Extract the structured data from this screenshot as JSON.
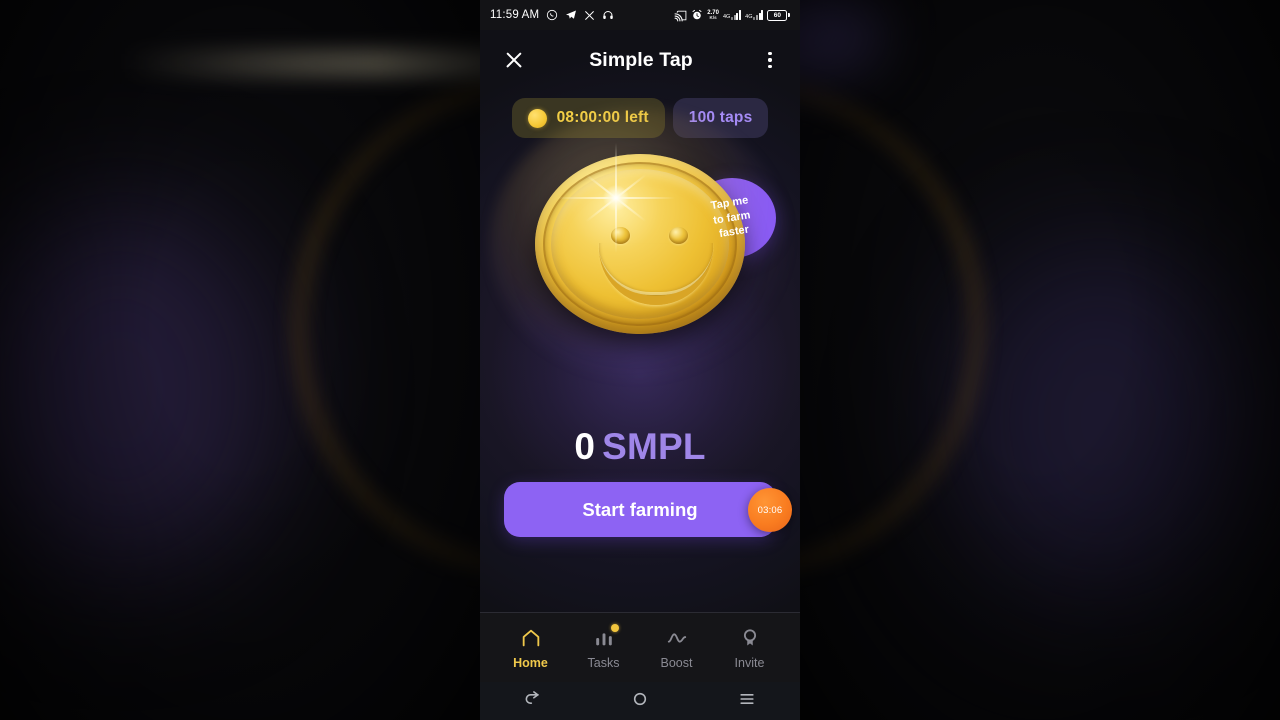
{
  "status_bar": {
    "time": "11:59 AM",
    "left_icons": [
      "whatsapp-icon",
      "telegram-icon",
      "x-icon",
      "headphone-icon"
    ],
    "network_speed": "2.70",
    "network_speed_unit": "K/s",
    "sim1_network": "4G",
    "sim2_network": "4G",
    "battery_percent": "60",
    "right_icons": [
      "cast-icon",
      "alarm-icon"
    ]
  },
  "app_bar": {
    "close_label": "close-icon",
    "title": "Simple Tap",
    "menu_label": "more-options-icon"
  },
  "badges": {
    "timer_text": "08:00:00 left",
    "taps_text": "100 taps"
  },
  "tooltip": {
    "line1": "Tap me",
    "line2": "to farm",
    "line3": "faster"
  },
  "balance": {
    "amount": "0",
    "currency": "SMPL"
  },
  "cta": {
    "label": "Start farming"
  },
  "recorder": {
    "elapsed": "03:06"
  },
  "bottom_nav": {
    "items": [
      {
        "label": "Home",
        "icon": "home-icon",
        "active": true,
        "badge": false
      },
      {
        "label": "Tasks",
        "icon": "chart-icon",
        "active": false,
        "badge": true
      },
      {
        "label": "Boost",
        "icon": "trend-icon",
        "active": false,
        "badge": false
      },
      {
        "label": "Invite",
        "icon": "medal-icon",
        "active": false,
        "badge": false
      }
    ]
  },
  "android_nav": {
    "back": "back-icon",
    "home": "home-circle-icon",
    "recents": "recents-icon"
  },
  "colors": {
    "accent_purple": "#8d63f3",
    "gold": "#f3cf46",
    "badge_taps_text": "#a58bf5",
    "rec_orange": "#f97c20"
  }
}
